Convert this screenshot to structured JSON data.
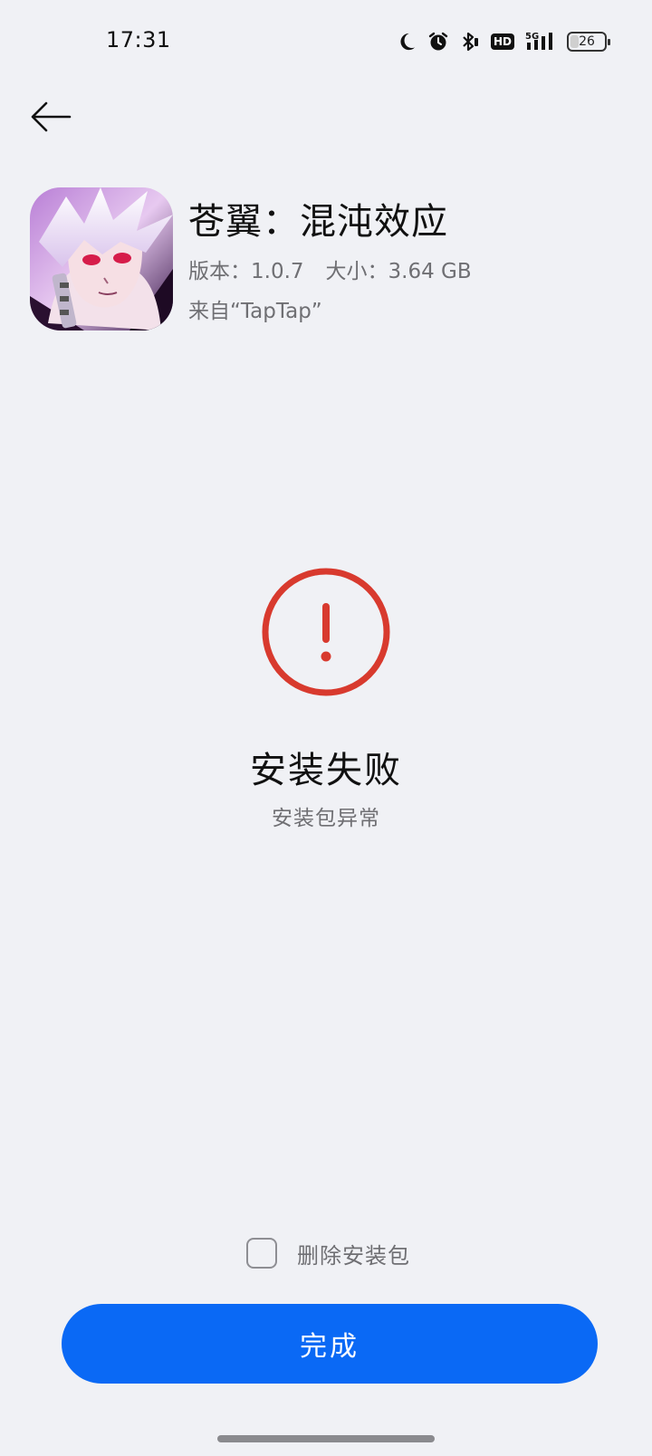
{
  "status_bar": {
    "time": "17:31",
    "icons": [
      "moon-icon",
      "alarm-icon",
      "bluetooth-icon",
      "hd-icon",
      "signal-5g-icon",
      "battery-icon"
    ],
    "hd_label": "HD",
    "network_label": "5G",
    "battery_level": "26",
    "battery_fraction": 0.26
  },
  "nav": {
    "back_icon": "arrow-left-icon"
  },
  "app": {
    "title": "苍翼：混沌效应",
    "version": "版本：1.0.7",
    "size": "大小：3.64 GB",
    "source": "来自“TapTap”"
  },
  "result": {
    "icon": "error-exclamation-icon",
    "status_color": "#d83a2e",
    "title": "安装失败",
    "subtitle": "安装包异常"
  },
  "options": {
    "delete_package_label": "删除安装包",
    "delete_package_checked": false
  },
  "actions": {
    "done_label": "完成",
    "accent_color": "#0a69f5"
  }
}
